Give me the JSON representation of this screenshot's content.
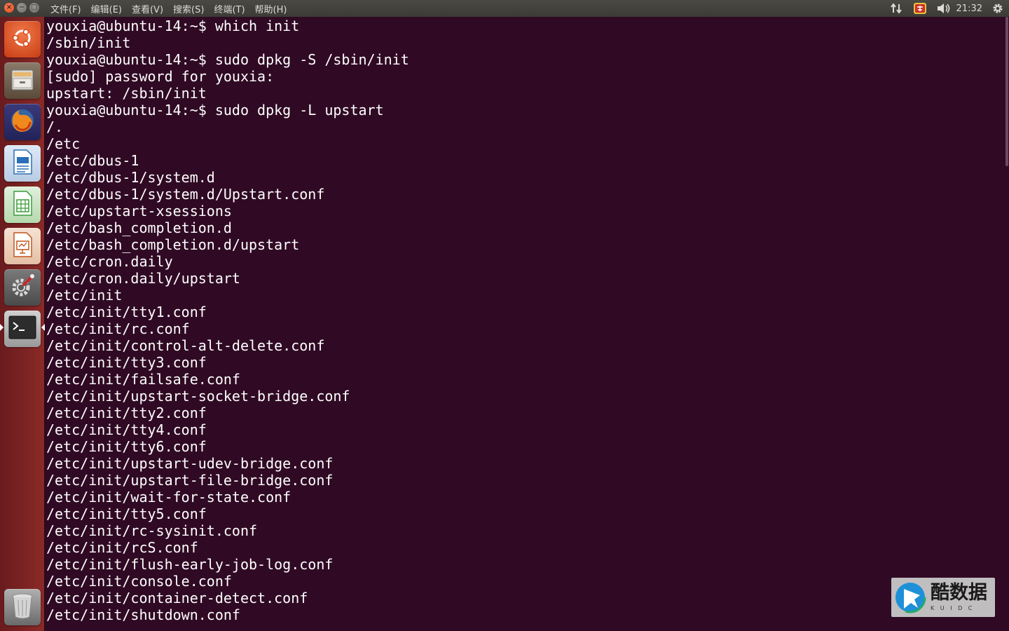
{
  "top_panel": {
    "window_buttons": {
      "close_icon": "close-icon",
      "min_icon": "minimize-icon",
      "max_icon": "maximize-icon"
    },
    "menus": [
      "文件(F)",
      "编辑(E)",
      "查看(V)",
      "搜索(S)",
      "终端(T)",
      "帮助(H)"
    ],
    "tray": {
      "network_icon": "network-updown-icon",
      "input_icon": "input-method-icon",
      "volume_icon": "volume-icon",
      "clock": "21:32",
      "settings_icon": "gear-icon"
    }
  },
  "launcher": {
    "items": [
      {
        "name": "dash-home",
        "icon": "ubuntu-logo-icon",
        "color": "#e95420"
      },
      {
        "name": "files",
        "icon": "file-cabinet-icon",
        "color": "#c8c6c0"
      },
      {
        "name": "firefox",
        "icon": "firefox-icon",
        "color": "#e66000"
      },
      {
        "name": "writer",
        "icon": "document-icon",
        "color": "#2a6fb8"
      },
      {
        "name": "calc",
        "icon": "spreadsheet-icon",
        "color": "#3a9b3a"
      },
      {
        "name": "impress",
        "icon": "presentation-icon",
        "color": "#c0561c"
      },
      {
        "name": "system-settings",
        "icon": "tools-icon",
        "color": "#8a8a8a"
      },
      {
        "name": "terminal",
        "icon": "terminal-icon",
        "color": "#3a3a3a"
      },
      {
        "name": "trash",
        "icon": "trash-icon",
        "color": "#9a9a9a"
      }
    ]
  },
  "terminal": {
    "lines": [
      "youxia@ubuntu-14:~$ which init",
      "/sbin/init",
      "youxia@ubuntu-14:~$ sudo dpkg -S /sbin/init",
      "[sudo] password for youxia:",
      "upstart: /sbin/init",
      "youxia@ubuntu-14:~$ sudo dpkg -L upstart",
      "/.",
      "/etc",
      "/etc/dbus-1",
      "/etc/dbus-1/system.d",
      "/etc/dbus-1/system.d/Upstart.conf",
      "/etc/upstart-xsessions",
      "/etc/bash_completion.d",
      "/etc/bash_completion.d/upstart",
      "/etc/cron.daily",
      "/etc/cron.daily/upstart",
      "/etc/init",
      "/etc/init/tty1.conf",
      "/etc/init/rc.conf",
      "/etc/init/control-alt-delete.conf",
      "/etc/init/tty3.conf",
      "/etc/init/failsafe.conf",
      "/etc/init/upstart-socket-bridge.conf",
      "/etc/init/tty2.conf",
      "/etc/init/tty4.conf",
      "/etc/init/tty6.conf",
      "/etc/init/upstart-udev-bridge.conf",
      "/etc/init/upstart-file-bridge.conf",
      "/etc/init/wait-for-state.conf",
      "/etc/init/tty5.conf",
      "/etc/init/rc-sysinit.conf",
      "/etc/init/rcS.conf",
      "/etc/init/flush-early-job-log.conf",
      "/etc/init/console.conf",
      "/etc/init/container-detect.conf",
      "/etc/init/shutdown.conf"
    ]
  },
  "watermark": {
    "logo_icon": "kuidc-logo-icon",
    "title": "酷数据",
    "subtitle": "K U I D C"
  }
}
